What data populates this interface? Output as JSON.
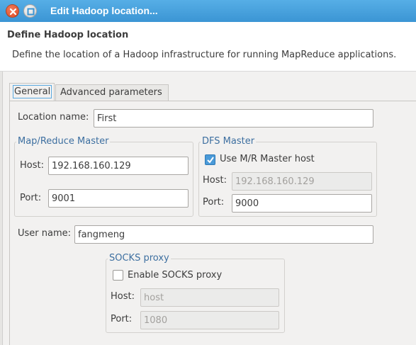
{
  "window": {
    "title": "Edit Hadoop location...",
    "close_icon": "close-icon",
    "maximize_icon": "maximize-icon"
  },
  "banner": {
    "title": "Define Hadoop location",
    "description": "Define the location of a Hadoop infrastructure for running MapReduce applications."
  },
  "tabs": [
    {
      "label": "General",
      "active": true
    },
    {
      "label": "Advanced parameters",
      "active": false
    }
  ],
  "general": {
    "location_name_label": "Location name:",
    "location_name_value": "First",
    "mr_master": {
      "title": "Map/Reduce Master",
      "host_label": "Host:",
      "host_value": "192.168.160.129",
      "port_label": "Port:",
      "port_value": "9001"
    },
    "dfs_master": {
      "title": "DFS Master",
      "use_mr_host_label": "Use M/R Master host",
      "use_mr_host_checked": true,
      "host_label": "Host:",
      "host_value": "192.168.160.129",
      "port_label": "Port:",
      "port_value": "9000"
    },
    "user_name_label": "User name:",
    "user_name_value": "fangmeng",
    "socks": {
      "title": "SOCKS proxy",
      "enable_label": "Enable SOCKS proxy",
      "enable_checked": false,
      "host_label": "Host:",
      "host_value": "host",
      "port_label": "Port:",
      "port_value": "1080"
    }
  },
  "colors": {
    "titlebar": "#3b95d4",
    "group_title": "#3d6fa0",
    "checkbox_checked": "#4a9ad8"
  }
}
